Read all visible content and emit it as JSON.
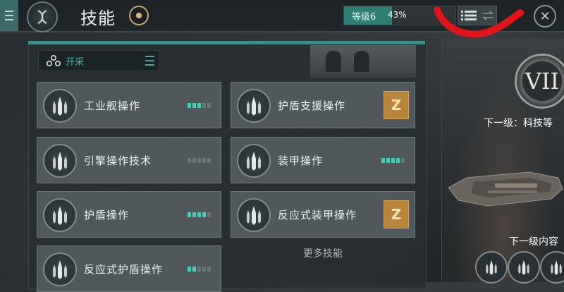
{
  "header": {
    "title": "技能",
    "level_label": "等级6",
    "level_percent_text": "43%",
    "level_progress": 0.43
  },
  "category": {
    "label": "开采"
  },
  "skills": [
    {
      "name": "工业舰操作",
      "level": 3,
      "max": 5,
      "badge": null
    },
    {
      "name": "护盾支援操作",
      "level": null,
      "max": 5,
      "badge": "Z"
    },
    {
      "name": "引擎操作技术",
      "level": 0,
      "max": 5,
      "badge": null
    },
    {
      "name": "装甲操作",
      "level": 4,
      "max": 5,
      "badge": null
    },
    {
      "name": "护盾操作",
      "level": 4,
      "max": 5,
      "badge": null
    },
    {
      "name": "反应式装甲操作",
      "level": null,
      "max": 5,
      "badge": "Z"
    },
    {
      "name": "反应式护盾操作",
      "level": 2,
      "max": 5,
      "badge": null
    }
  ],
  "more_skills_label": "更多技能",
  "right_panel": {
    "tier": "VII",
    "next_level_text": "下一级：科技等",
    "next_content_text": "下一级内容"
  },
  "colors": {
    "accent_teal": "#3c8e88",
    "pip_on": "#3fd0b8",
    "badge_gold": "#b8853a",
    "red_annotation": "#e0151a"
  },
  "icons": {
    "menu": "menu-icon",
    "skill_emblem": "dna-icon",
    "category": "cluster-icon",
    "skill": "ship-icon",
    "list_view": "list-view-icon",
    "swap": "swap-icon",
    "close": "close-icon"
  }
}
